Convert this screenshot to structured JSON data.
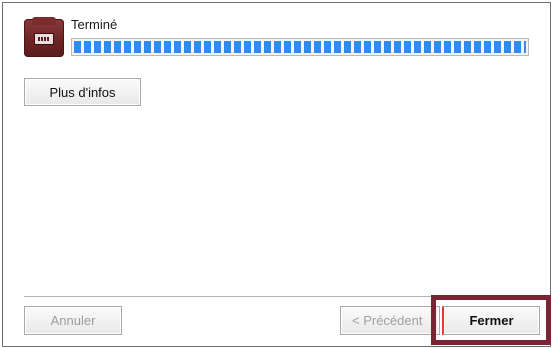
{
  "status": {
    "title": "Terminé",
    "progress_fraction": 1.0
  },
  "buttons": {
    "more_info": "Plus d'infos",
    "cancel": "Annuler",
    "previous": "< Précédent",
    "close": "Fermer"
  },
  "colors": {
    "progress_blue": "#2f8bf0",
    "highlight_border": "#7b2433",
    "installer_icon": "#6e2525"
  },
  "icons": {
    "installer": "installer-box-icon"
  }
}
